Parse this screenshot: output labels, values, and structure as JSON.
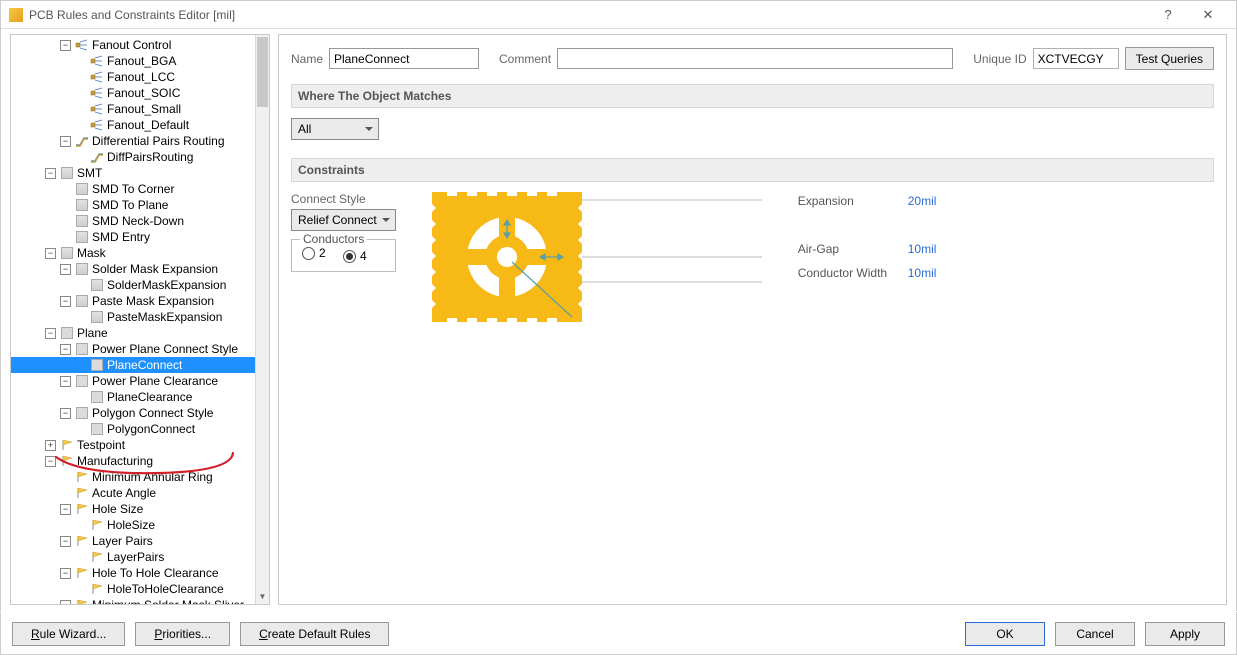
{
  "window": {
    "title": "PCB Rules and Constraints Editor [mil]"
  },
  "tree": [
    {
      "d": 3,
      "tw": "-",
      "icon": "fanout",
      "label": "Fanout Control"
    },
    {
      "d": 4,
      "tw": " ",
      "icon": "fanout",
      "label": "Fanout_BGA"
    },
    {
      "d": 4,
      "tw": " ",
      "icon": "fanout",
      "label": "Fanout_LCC"
    },
    {
      "d": 4,
      "tw": " ",
      "icon": "fanout",
      "label": "Fanout_SOIC"
    },
    {
      "d": 4,
      "tw": " ",
      "icon": "fanout",
      "label": "Fanout_Small"
    },
    {
      "d": 4,
      "tw": " ",
      "icon": "fanout",
      "label": "Fanout_Default"
    },
    {
      "d": 3,
      "tw": "-",
      "icon": "route",
      "label": "Differential Pairs Routing"
    },
    {
      "d": 4,
      "tw": " ",
      "icon": "route",
      "label": "DiffPairsRouting"
    },
    {
      "d": 2,
      "tw": "-",
      "icon": "sq",
      "label": "SMT"
    },
    {
      "d": 3,
      "tw": " ",
      "icon": "sq",
      "label": "SMD To Corner"
    },
    {
      "d": 3,
      "tw": " ",
      "icon": "sq",
      "label": "SMD To Plane"
    },
    {
      "d": 3,
      "tw": " ",
      "icon": "sq",
      "label": "SMD Neck-Down"
    },
    {
      "d": 3,
      "tw": " ",
      "icon": "sq",
      "label": "SMD Entry"
    },
    {
      "d": 2,
      "tw": "-",
      "icon": "sq",
      "label": "Mask"
    },
    {
      "d": 3,
      "tw": "-",
      "icon": "sq",
      "label": "Solder Mask Expansion"
    },
    {
      "d": 4,
      "tw": " ",
      "icon": "sq",
      "label": "SolderMaskExpansion"
    },
    {
      "d": 3,
      "tw": "-",
      "icon": "sq",
      "label": "Paste Mask Expansion"
    },
    {
      "d": 4,
      "tw": " ",
      "icon": "sq",
      "label": "PasteMaskExpansion"
    },
    {
      "d": 2,
      "tw": "-",
      "icon": "sqd",
      "label": "Plane"
    },
    {
      "d": 3,
      "tw": "-",
      "icon": "sqd",
      "label": "Power Plane Connect Style"
    },
    {
      "d": 4,
      "tw": " ",
      "icon": "sqd",
      "label": "PlaneConnect",
      "sel": true
    },
    {
      "d": 3,
      "tw": "-",
      "icon": "sqd",
      "label": "Power Plane Clearance"
    },
    {
      "d": 4,
      "tw": " ",
      "icon": "sqd",
      "label": "PlaneClearance"
    },
    {
      "d": 3,
      "tw": "-",
      "icon": "sqd",
      "label": "Polygon Connect Style"
    },
    {
      "d": 4,
      "tw": " ",
      "icon": "sqd",
      "label": "PolygonConnect"
    },
    {
      "d": 2,
      "tw": "+",
      "icon": "flag",
      "label": "Testpoint"
    },
    {
      "d": 2,
      "tw": "-",
      "icon": "flag",
      "label": "Manufacturing"
    },
    {
      "d": 3,
      "tw": " ",
      "icon": "flag",
      "label": "Minimum Annular Ring"
    },
    {
      "d": 3,
      "tw": " ",
      "icon": "flag",
      "label": "Acute Angle"
    },
    {
      "d": 3,
      "tw": "-",
      "icon": "flag",
      "label": "Hole Size"
    },
    {
      "d": 4,
      "tw": " ",
      "icon": "flag",
      "label": "HoleSize"
    },
    {
      "d": 3,
      "tw": "-",
      "icon": "flag",
      "label": "Layer Pairs"
    },
    {
      "d": 4,
      "tw": " ",
      "icon": "flag",
      "label": "LayerPairs"
    },
    {
      "d": 3,
      "tw": "-",
      "icon": "flag",
      "label": "Hole To Hole Clearance"
    },
    {
      "d": 4,
      "tw": " ",
      "icon": "flag",
      "label": "HoleToHoleClearance"
    },
    {
      "d": 3,
      "tw": "-",
      "icon": "flag",
      "label": "Minimum Solder Mask Sliver"
    }
  ],
  "fields": {
    "name_label": "Name",
    "name_value": "PlaneConnect",
    "comment_label": "Comment",
    "comment_value": "",
    "uid_label": "Unique ID",
    "uid_value": "XCTVECGY",
    "test_queries": "Test Queries"
  },
  "sections": {
    "where": "Where The Object Matches",
    "where_sel": "All",
    "constraints": "Constraints"
  },
  "constraints": {
    "style_label": "Connect Style",
    "style_value": "Relief Connect",
    "conductors_label": "Conductors",
    "opt2": "2",
    "opt4": "4",
    "props": [
      {
        "label": "Expansion",
        "value": "20mil"
      },
      {
        "label": "Air-Gap",
        "value": "10mil"
      },
      {
        "label": "Conductor Width",
        "value": "10mil"
      }
    ]
  },
  "footer": {
    "rule_wizard": "Rule Wizard...",
    "priorities": "Priorities...",
    "create_default": "Create Default Rules",
    "ok": "OK",
    "cancel": "Cancel",
    "apply": "Apply"
  }
}
